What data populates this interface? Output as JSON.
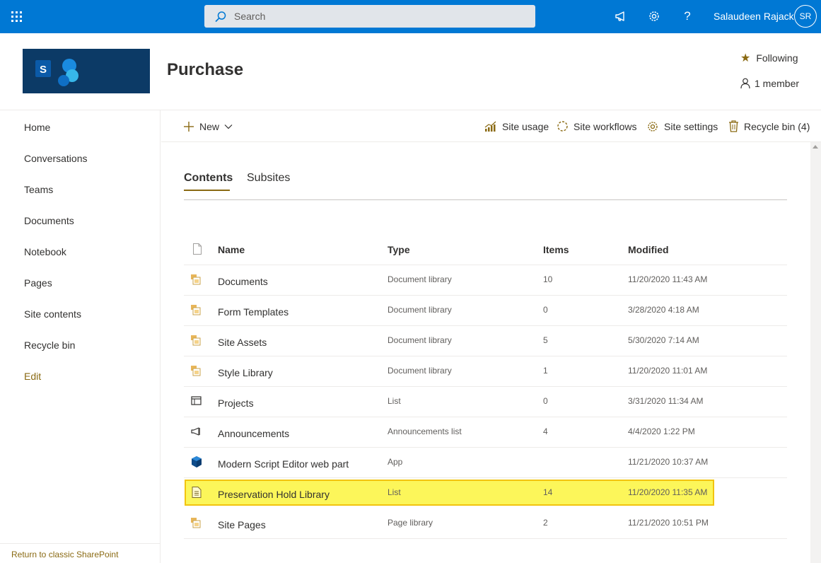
{
  "suite_bar": {
    "search_placeholder": "Search",
    "user_name": "Salaudeen Rajack",
    "avatar_initials": "SR",
    "color": "#0078d4"
  },
  "site": {
    "title": "Purchase",
    "follow_label": "Following",
    "members_label": "1 member",
    "logo_letter": "S"
  },
  "left_nav": {
    "items": [
      "Home",
      "Conversations",
      "Teams",
      "Documents",
      "Notebook",
      "Pages",
      "Site contents",
      "Recycle bin"
    ],
    "edit_label": "Edit",
    "classic_link": "Return to classic SharePoint"
  },
  "command_bar": {
    "new_label": "New",
    "site_usage": "Site usage",
    "site_workflows": "Site workflows",
    "site_settings": "Site settings",
    "recycle_bin": "Recycle bin (4)"
  },
  "tabs": {
    "contents": "Contents",
    "subsites": "Subsites"
  },
  "table": {
    "headers": {
      "name": "Name",
      "type": "Type",
      "items": "Items",
      "modified": "Modified"
    },
    "rows": [
      {
        "icon": "document-library-icon",
        "name": "Documents",
        "type": "Document library",
        "items": "10",
        "modified": "11/20/2020 11:43 AM"
      },
      {
        "icon": "document-library-icon",
        "name": "Form Templates",
        "type": "Document library",
        "items": "0",
        "modified": "3/28/2020 4:18 AM"
      },
      {
        "icon": "document-library-icon",
        "name": "Site Assets",
        "type": "Document library",
        "items": "5",
        "modified": "5/30/2020 7:14 AM"
      },
      {
        "icon": "document-library-icon",
        "name": "Style Library",
        "type": "Document library",
        "items": "1",
        "modified": "11/20/2020 11:01 AM"
      },
      {
        "icon": "list-icon",
        "name": "Projects",
        "type": "List",
        "items": "0",
        "modified": "3/31/2020 11:34 AM"
      },
      {
        "icon": "megaphone-icon",
        "name": "Announcements",
        "type": "Announcements list",
        "items": "4",
        "modified": "4/4/2020 1:22 PM"
      },
      {
        "icon": "app-icon",
        "name": "Modern Script Editor web part",
        "type": "App",
        "items": "",
        "modified": "11/21/2020 10:37 AM"
      },
      {
        "icon": "page-list-icon",
        "name": "Preservation Hold Library",
        "type": "List",
        "items": "14",
        "modified": "11/20/2020 11:35 AM"
      },
      {
        "icon": "document-library-icon",
        "name": "Site Pages",
        "type": "Page library",
        "items": "2",
        "modified": "11/21/2020 10:51 PM"
      }
    ],
    "highlight_color": "#fcf65a"
  },
  "theme": {
    "accent": "#8a6a13",
    "logo_bg": "#0c3a66"
  }
}
